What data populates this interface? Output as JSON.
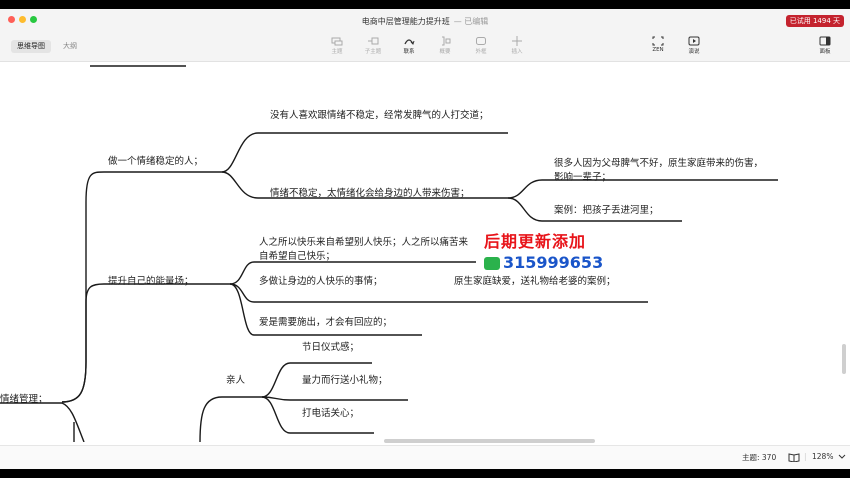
{
  "window": {
    "title": "电商中层管理能力提升班",
    "save_status": "— 已编辑",
    "trial_badge": "已试用 1494 天"
  },
  "view_tabs": {
    "mindmap": "思维导图",
    "outline": "大纲"
  },
  "toolbar": {
    "topic": "主题",
    "subtopic": "子主题",
    "relation": "联系",
    "summary": "概要",
    "boundary": "外框",
    "insert": "插入",
    "zen": "ZEN",
    "present": "演说",
    "panel": "面板"
  },
  "mindmap": {
    "root": "情绪管理；",
    "branch1": {
      "label": "做一个情绪稳定的人；",
      "c1": "没有人喜欢跟情绪不稳定，经常发脾气的人打交道；",
      "c2": "情绪不稳定，太情绪化会给身边的人带来伤害；",
      "c2a": "很多人因为父母脾气不好，原生家庭带来的伤害，影响一辈子；",
      "c2b": "案例：把孩子丢进河里；"
    },
    "branch2": {
      "label": "提升自己的能量场；",
      "c1": "人之所以快乐来自希望别人快乐；人之所以痛苦来自希望自己快乐；",
      "c2": "多做让身边的人快乐的事情；",
      "c2a": "原生家庭缺爱，送礼物给老婆的案例；",
      "c3": "爱是需要施出，才会有回应的；"
    },
    "branch3": {
      "label": "亲人",
      "c1": "节日仪式感；",
      "c2": "量力而行送小礼物；",
      "c3": "打电话关心；"
    }
  },
  "watermark": {
    "line1": "后期更新添加",
    "line2": "315999653"
  },
  "statusbar": {
    "topics": "主题: 370",
    "zoom": "128%"
  },
  "colors": {
    "accent_red": "#c4232e",
    "line": "#1a1a1a"
  }
}
